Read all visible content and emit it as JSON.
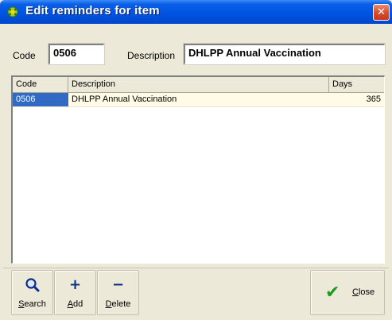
{
  "window": {
    "title": "Edit reminders for item",
    "close_glyph": "✕",
    "icon": "app-icon"
  },
  "form": {
    "code_label": "Code",
    "code_value": "0506",
    "description_label": "Description",
    "description_value": "DHLPP Annual Vaccination"
  },
  "grid": {
    "columns": [
      "Code",
      "Description",
      "Days"
    ],
    "rows": [
      {
        "code": "0506",
        "description": "DHLPP Annual Vaccination",
        "days": "365",
        "selected": true
      }
    ]
  },
  "toolbar": {
    "search": {
      "icon": "magnifier-icon",
      "glyph": "🔍",
      "label_first": "S",
      "label_rest": "earch"
    },
    "add": {
      "icon": "plus-icon",
      "glyph": "+",
      "label_first": "A",
      "label_rest": "dd"
    },
    "delete": {
      "icon": "minus-icon",
      "glyph": "−",
      "label_first": "D",
      "label_rest": "elete"
    },
    "close": {
      "icon": "checkmark-icon",
      "glyph": "✔",
      "label_first": "C",
      "label_rest": "lose"
    }
  },
  "colors": {
    "titlebar": "#0054e3",
    "selection": "#316ac5",
    "row_highlight": "#fffbe6",
    "check": "#1f9a1f",
    "close_button": "#d74a2a"
  }
}
